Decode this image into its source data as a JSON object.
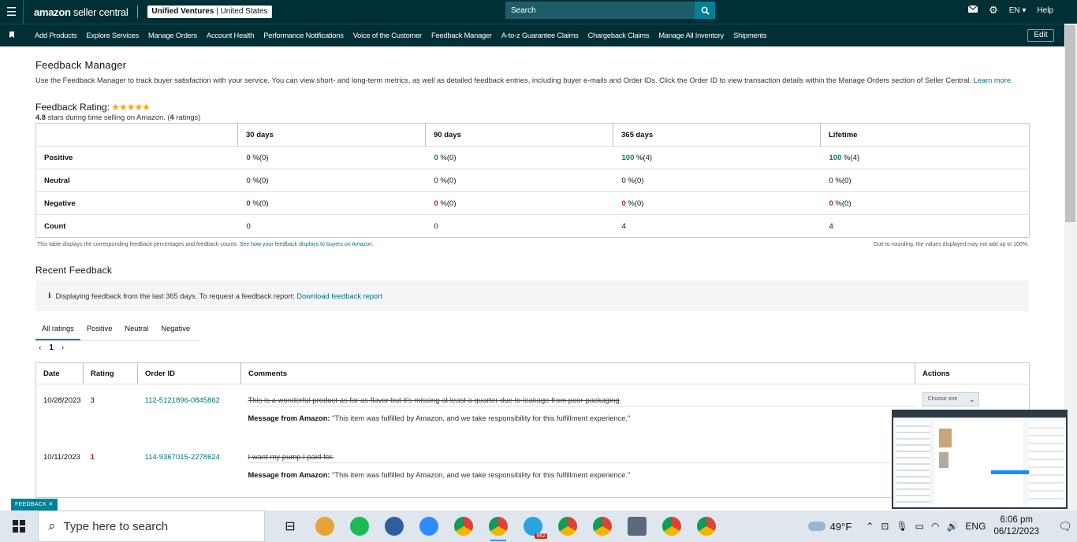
{
  "topbar": {
    "logo_brand": "amazon",
    "logo_rest": " seller central",
    "store_name": "Unified Ventures",
    "store_sep": " | ",
    "store_country": "United States",
    "search_placeholder": "Search",
    "language": "EN ▾",
    "help": "Help"
  },
  "nav": {
    "items": [
      "Add Products",
      "Explore Services",
      "Manage Orders",
      "Account Health",
      "Performance Notifications",
      "Voice of the Customer",
      "Feedback Manager",
      "A-to-z Guarantee Claims",
      "Chargeback Claims",
      "Manage All Inventory",
      "Shipments"
    ],
    "edit": "Edit"
  },
  "page": {
    "title": "Feedback Manager",
    "intro": "Use the Feedback Manager to track buyer satisfaction with your service. You can view short- and long-term metrics, as well as detailed feedback entries, including buyer e-mails and Order IDs. Click the Order ID to view transaction details within the Manage Orders section of Seller Central.",
    "learn_more": "Learn more",
    "rating_label": "Feedback Rating:",
    "rating_stars": "★★★★★",
    "rating_value": "4.8",
    "rating_text": " stars during time selling on Amazon. (",
    "rating_count": "4",
    "rating_count_suffix": " ratings)"
  },
  "metrics": {
    "headers": [
      "30 days",
      "90 days",
      "365 days",
      "Lifetime"
    ],
    "rows": [
      {
        "label": "Positive",
        "cells": [
          [
            "0",
            " %(0)"
          ],
          [
            "0",
            " %(0)"
          ],
          [
            "100",
            " %(4)"
          ],
          [
            "100",
            " %(4)"
          ]
        ]
      },
      {
        "label": "Neutral",
        "cells": [
          [
            "0",
            " %(0)"
          ],
          [
            "0",
            " %(0)"
          ],
          [
            "0",
            " %(0)"
          ],
          [
            "0",
            " %(0)"
          ]
        ]
      },
      {
        "label": "Negative",
        "cells": [
          [
            "0",
            " %(0)"
          ],
          [
            "0",
            " %(0)"
          ],
          [
            "0",
            " %(0)"
          ],
          [
            "0",
            " %(0)"
          ]
        ]
      },
      {
        "label": "Count",
        "cells": [
          [
            "0",
            ""
          ],
          [
            "0",
            ""
          ],
          [
            "4",
            ""
          ],
          [
            "4",
            ""
          ]
        ]
      }
    ],
    "note_left": "This table displays the corresponding feedback percentages and feedback counts.",
    "note_left_link": "See how your feedback displays to buyers on Amazon.",
    "note_right": "Due to rounding, the values displayed may not add up to 100%."
  },
  "recent": {
    "title": "Recent Feedback",
    "info_text": "Displaying feedback from the last 365 days. To request a feedback report:",
    "info_link": "Download feedback report",
    "tabs": [
      "All ratings",
      "Positive",
      "Neutral",
      "Negative"
    ],
    "page": "1",
    "columns": [
      "Date",
      "Rating",
      "Order ID",
      "Comments",
      "Actions"
    ],
    "rows": [
      {
        "date": "10/28/2023",
        "rating": "3",
        "order_id": "112-5121896-0845862",
        "comment": "This is a wonderful product as far as flavor but it's missing at least a quarter due to leakage from poor packaging",
        "msg_label": "Message from Amazon:",
        "msg": " \"This item was fulfilled by Amazon, and we take responsibility for this fulfillment experience.\"",
        "action": "Choose one"
      },
      {
        "date": "10/11/2023",
        "rating": "1",
        "order_id": "114-9367015-2278624",
        "comment": "I want my pump I paid for.",
        "msg_label": "Message from Amazon:",
        "msg": " \"This item was fulfilled by Amazon, and we take responsibility for this fulfillment experience.\""
      }
    ]
  },
  "feedback_tab": "FEEDBACK ✕",
  "taskbar": {
    "search_placeholder": "Type here to search",
    "temperature": "49°F",
    "language": "ENG",
    "time": "6:06 pm",
    "date": "06/12/2023",
    "telegram_badge": "962"
  },
  "colors": {
    "header_bg": "#002f36",
    "accent": "#008296",
    "link": "#007185",
    "positive": "#067d62",
    "negative": "#b12704",
    "stars": "#ffa41c"
  }
}
